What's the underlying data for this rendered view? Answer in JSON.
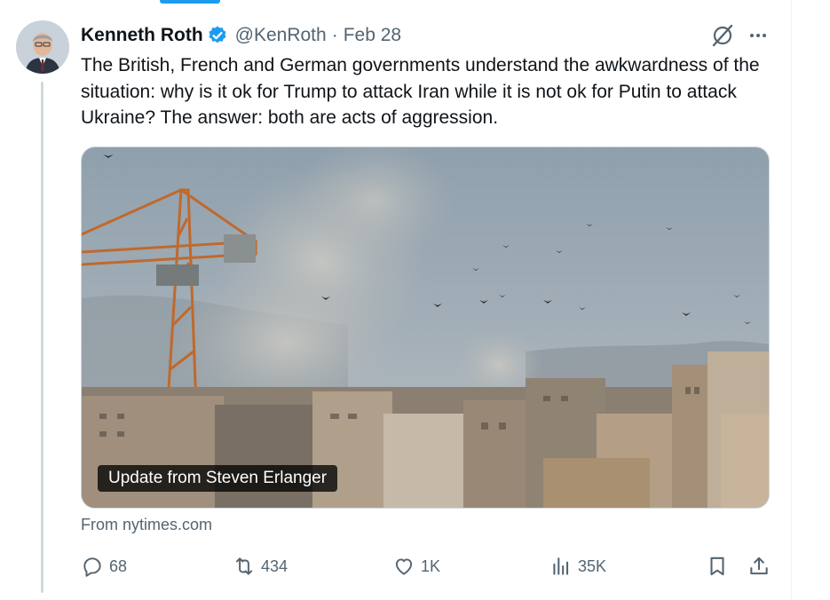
{
  "tweet": {
    "author_name": "Kenneth Roth",
    "handle": "@KenRoth",
    "separator": "·",
    "date": "Feb 28",
    "text": "The British, French and German governments understand the awkwardness of the situation: why is it ok for Trump to attack Iran while it is not ok for Putin to attack Ukraine? The answer: both are acts of aggression.",
    "media_caption": "Update from Steven Erlanger",
    "source": "From nytimes.com"
  },
  "actions": {
    "replies": "68",
    "reposts": "434",
    "likes": "1K",
    "views": "35K"
  },
  "icons": {
    "verified": "verified-badge-icon",
    "grok": "grok-icon",
    "more": "more-icon",
    "reply": "reply-icon",
    "repost": "repost-icon",
    "like": "like-icon",
    "views": "views-icon",
    "bookmark": "bookmark-icon",
    "share": "share-icon"
  },
  "colors": {
    "accent": "#1d9bf0",
    "text_primary": "#0f1419",
    "text_secondary": "#536471",
    "thread_line": "#cfd9de"
  }
}
